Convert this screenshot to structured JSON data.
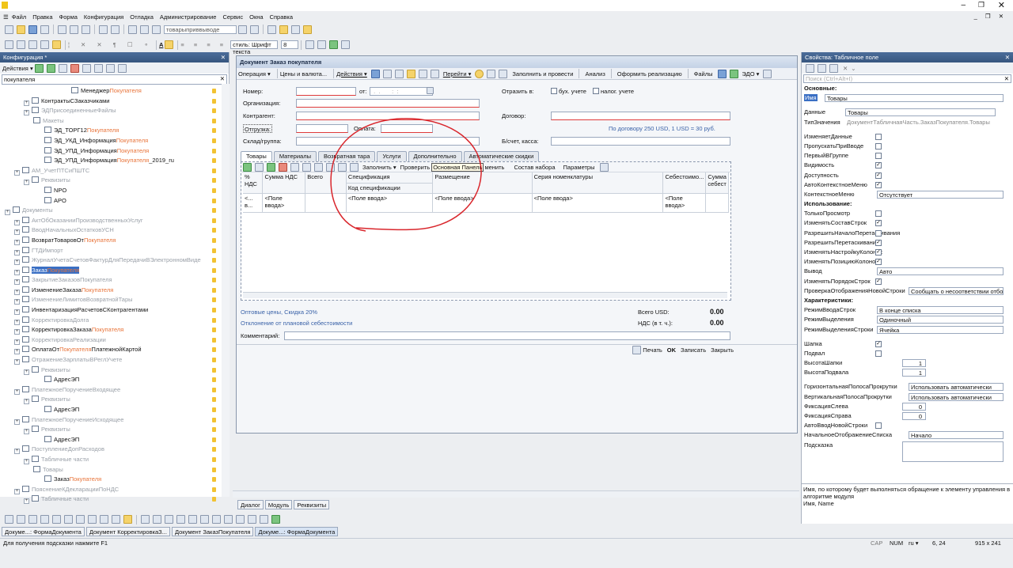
{
  "menubar": [
    "Файл",
    "Правка",
    "Форма",
    "Конфигурация",
    "Отладка",
    "Администрирование",
    "Сервис",
    "Окна",
    "Справка"
  ],
  "toolbar": {
    "combo1": "товарыприввыводе",
    "combo2": "стиль: Шрифт текста",
    "combo3": "8"
  },
  "left": {
    "title": "Конфигурация *",
    "actions": "Действия ▾",
    "search": "покупателя",
    "tree": [
      {
        "pre": "МенеджерПокупателя",
        "indent": 90,
        "parts": [
          [
            "Менеджер",
            ""
          ],
          [
            "Покупателя",
            "o"
          ]
        ]
      },
      {
        "indent": 30,
        "parts": [
          [
            "КонтрактыСЗаказчиками",
            ""
          ]
        ]
      },
      {
        "indent": 30,
        "parts": [
          [
            "ЭДПрисоединенныеФайлы",
            "g"
          ]
        ]
      },
      {
        "indent": 42,
        "parts": [
          [
            "Макеты",
            "g"
          ]
        ]
      },
      {
        "indent": 56,
        "parts": [
          [
            "ЭД_ТОРГ12",
            ""
          ],
          [
            "Покупателя",
            "o"
          ]
        ]
      },
      {
        "indent": 56,
        "parts": [
          [
            "ЭД_УКД_Информация",
            ""
          ],
          [
            "Покупателя",
            "o"
          ]
        ]
      },
      {
        "indent": 56,
        "parts": [
          [
            "ЭД_УПД_Информация",
            ""
          ],
          [
            "Покупателя",
            "o"
          ]
        ]
      },
      {
        "indent": 56,
        "parts": [
          [
            "ЭД_УПД_Информация",
            ""
          ],
          [
            "Покупателя",
            "o"
          ],
          [
            "_2019_ru",
            ""
          ]
        ]
      },
      {
        "indent": 18,
        "parts": [
          [
            "АМ_УчетПТСиПШТС",
            "g"
          ]
        ]
      },
      {
        "indent": 30,
        "parts": [
          [
            "Реквизиты",
            "g"
          ]
        ]
      },
      {
        "indent": 56,
        "parts": [
          [
            "NPO",
            ""
          ]
        ]
      },
      {
        "indent": 56,
        "parts": [
          [
            "APO",
            ""
          ]
        ]
      },
      {
        "indent": 6,
        "parts": [
          [
            "Документы",
            "g"
          ]
        ]
      },
      {
        "indent": 18,
        "parts": [
          [
            "АктОбОказанииПроизводственныхУслуг",
            "g"
          ]
        ]
      },
      {
        "indent": 18,
        "parts": [
          [
            "ВводНачальныхОстатковУСН",
            "g"
          ]
        ]
      },
      {
        "indent": 18,
        "parts": [
          [
            "ВозвратТоваровОт",
            ""
          ],
          [
            "Покупателя",
            "o"
          ]
        ]
      },
      {
        "indent": 18,
        "parts": [
          [
            "ГТДИмпорт",
            "g"
          ]
        ]
      },
      {
        "indent": 18,
        "parts": [
          [
            "ЖурналУчетаСчетовФактурДляПередачиВЭлектронномВиде",
            "g"
          ]
        ]
      },
      {
        "indent": 18,
        "parts": [
          [
            "Заказ",
            ""
          ],
          [
            "Покупателя",
            "o"
          ]
        ],
        "selected": true
      },
      {
        "indent": 18,
        "parts": [
          [
            "ЗакрытиеЗаказовПокупателя",
            "g"
          ]
        ]
      },
      {
        "indent": 18,
        "parts": [
          [
            "ИзменениеЗаказа",
            ""
          ],
          [
            "Покупателя",
            "o"
          ]
        ]
      },
      {
        "indent": 18,
        "parts": [
          [
            "ИзменениеЛимитовВозвратнойТары",
            "g"
          ]
        ]
      },
      {
        "indent": 18,
        "parts": [
          [
            "ИнвентаризацияРасчетовСКонтрагентами",
            ""
          ]
        ]
      },
      {
        "indent": 18,
        "parts": [
          [
            "КорректировкаДолга",
            "g"
          ]
        ]
      },
      {
        "indent": 18,
        "parts": [
          [
            "КорректировкаЗаказа",
            ""
          ],
          [
            "Покупателя",
            "o"
          ]
        ]
      },
      {
        "indent": 18,
        "parts": [
          [
            "КорректировкаРеализации",
            "g"
          ]
        ]
      },
      {
        "indent": 18,
        "parts": [
          [
            "ОплатаОт",
            ""
          ],
          [
            "Покупателя",
            "o"
          ],
          [
            "ПлатежнойКартой",
            ""
          ]
        ]
      },
      {
        "indent": 18,
        "parts": [
          [
            "ОтражениеЗарплатыВРеглУчете",
            "g"
          ]
        ]
      },
      {
        "indent": 30,
        "parts": [
          [
            "Реквизиты",
            "g"
          ]
        ]
      },
      {
        "indent": 56,
        "parts": [
          [
            "АдресЭП",
            ""
          ]
        ]
      },
      {
        "indent": 18,
        "parts": [
          [
            "ПлатежноеПоручениеВходящее",
            "g"
          ]
        ]
      },
      {
        "indent": 30,
        "parts": [
          [
            "Реквизиты",
            "g"
          ]
        ]
      },
      {
        "indent": 56,
        "parts": [
          [
            "АдресЭП",
            ""
          ]
        ]
      },
      {
        "indent": 18,
        "parts": [
          [
            "ПлатежноеПоручениеИсходящее",
            "g"
          ]
        ]
      },
      {
        "indent": 30,
        "parts": [
          [
            "Реквизиты",
            "g"
          ]
        ]
      },
      {
        "indent": 56,
        "parts": [
          [
            "АдресЭП",
            ""
          ]
        ]
      },
      {
        "indent": 18,
        "parts": [
          [
            "ПоступлениеДопРасходов",
            "g"
          ]
        ]
      },
      {
        "indent": 30,
        "parts": [
          [
            "Табличные части",
            "g"
          ]
        ]
      },
      {
        "indent": 42,
        "parts": [
          [
            "Товары",
            "g"
          ]
        ]
      },
      {
        "indent": 56,
        "parts": [
          [
            "Заказ",
            ""
          ],
          [
            "Покупателя",
            "o"
          ]
        ]
      },
      {
        "indent": 18,
        "parts": [
          [
            "ПояснениеКДекларацииПоНДС",
            "g"
          ]
        ]
      },
      {
        "indent": 30,
        "parts": [
          [
            "Табличные части",
            "g"
          ]
        ]
      }
    ]
  },
  "doc": {
    "title": "Документ Заказ покупателя",
    "cmd": [
      "Операция ▾",
      "Цены и валюта...",
      "Действия ▾",
      "Перейти ▾",
      "Заполнить и провести",
      "Анализ",
      "Оформить реализацию",
      "Файлы",
      "ЭДО ▾"
    ],
    "labels": {
      "number": "Номер:",
      "from": "от:",
      "org": "Организация:",
      "kontr": "Контрагент:",
      "otgruzka": "Отгрузка:",
      "oplata": "Оплата:",
      "sklad": "Склад/группа:",
      "dogovor": "Договор:",
      "bschet": "Б/счет, касса:",
      "otrazit": "Отразить в:",
      "buh": "бух. учете",
      "nalog": "налог. учете"
    },
    "date_placeholder": "  .  .       :  :  ",
    "dogovor_note": "По договору 250 USD, 1 USD = 30 руб.",
    "tabs": [
      "Товары",
      "Материалы",
      "Возвратная тара",
      "Услуги",
      "Дополнительно",
      "Автоматические скидки"
    ],
    "gridbar": [
      "Заполнить ▾",
      "Проверить",
      "Основная Панель",
      "менить",
      "Состав набора",
      "Параметры"
    ],
    "columns": [
      "% НДС",
      "Сумма НДС",
      "Всего",
      "Спецификация",
      "Размещение",
      "Серия номенклатуры",
      "Себестоимо...",
      "Сумма себест"
    ],
    "subcol": "Код спецификации",
    "row": {
      "c0": "<...",
      "c0b": "в...",
      "inp": "<Поле ввода>",
      "inp2": "<Поле",
      "inp2b": "ввода>"
    },
    "footer": {
      "prices": "Оптовые цены, Скидка 20%",
      "dev": "Отклонение от плановой себестоимости",
      "total_lbl": "Всего USD:",
      "total": "0.00",
      "vat_lbl": "НДС (в т. ч.):",
      "vat": "0.00",
      "comment": "Комментарий:"
    },
    "buttons": [
      "Печать",
      "OK",
      "Записать",
      "Закрыть"
    ],
    "bottom_tabs": [
      "Диалог",
      "Модуль",
      "Реквизиты"
    ]
  },
  "props": {
    "title": "Свойства: Табличное поле",
    "search": "Поиск (Ctrl+Alt+I)",
    "rows": [
      {
        "t": "sec",
        "l": "Основные:"
      },
      {
        "t": "inp",
        "l": "Имя",
        "v": "Товары",
        "hl": true
      },
      {
        "t": "sp"
      },
      {
        "t": "inp",
        "l": "Данные",
        "v": "Товары"
      },
      {
        "t": "inp",
        "l": "ТипЗначения",
        "v": "ДокументТабличнаяЧасть.ЗаказПокупателя.Товары",
        "g": true
      },
      {
        "t": "sp"
      },
      {
        "t": "cb",
        "l": "ИзменяетДанные",
        "c": false
      },
      {
        "t": "cb",
        "l": "ПропускатьПриВводе",
        "c": false
      },
      {
        "t": "cb",
        "l": "ПервыйВГруппе",
        "c": false
      },
      {
        "t": "cb",
        "l": "Видимость",
        "c": true
      },
      {
        "t": "cb",
        "l": "Доступность",
        "c": true
      },
      {
        "t": "cb",
        "l": "АвтоКонтекстноеМеню",
        "c": true
      },
      {
        "t": "inp",
        "l": "КонтекстноеМеню",
        "v": "Отсутствует"
      },
      {
        "t": "sec",
        "l": "Использование:"
      },
      {
        "t": "cb",
        "l": "ТолькоПросмотр",
        "c": false
      },
      {
        "t": "cb",
        "l": "ИзменятьСоставСтрок",
        "c": true
      },
      {
        "t": "cb",
        "l": "РазрешитьНачалоПеретаскивания",
        "c": false
      },
      {
        "t": "cb",
        "l": "РазрешитьПеретаскивание",
        "c": true
      },
      {
        "t": "cb",
        "l": "ИзменятьНастройкуКолонок",
        "c": true
      },
      {
        "t": "cb",
        "l": "ИзменятьПозициюКолонок",
        "c": true
      },
      {
        "t": "inp",
        "l": "Вывод",
        "v": "Авто"
      },
      {
        "t": "cb",
        "l": "ИзменятьПорядокСтрок",
        "c": true
      },
      {
        "t": "inp",
        "l": "ПроверкаОтображенияНовойСтроки",
        "v": "Сообщать о несоответствии отбору"
      },
      {
        "t": "sec",
        "l": "Характеристики:"
      },
      {
        "t": "inp",
        "l": "РежимВводаСтрок",
        "v": "В конце списка"
      },
      {
        "t": "inp",
        "l": "РежимВыделения",
        "v": "Одиночный"
      },
      {
        "t": "inp",
        "l": "РежимВыделенияСтроки",
        "v": "Ячейка"
      },
      {
        "t": "sp"
      },
      {
        "t": "cb",
        "l": "Шапка",
        "c": true
      },
      {
        "t": "cb",
        "l": "Подвал",
        "c": false
      },
      {
        "t": "num",
        "l": "ВысотаШапки",
        "v": "1"
      },
      {
        "t": "num",
        "l": "ВысотаПодвала",
        "v": "1"
      },
      {
        "t": "sp"
      },
      {
        "t": "inp",
        "l": "ГоризонтальнаяПолосаПрокрутки",
        "v": "Использовать автоматически"
      },
      {
        "t": "inp",
        "l": "ВертикальнаяПолосаПрокрутки",
        "v": "Использовать автоматически"
      },
      {
        "t": "num",
        "l": "ФиксацияСлева",
        "v": "0"
      },
      {
        "t": "num",
        "l": "ФиксацияСправа",
        "v": "0"
      },
      {
        "t": "cb",
        "l": "АвтоВводНовойСтроки",
        "c": false
      },
      {
        "t": "inp",
        "l": "НачальноеОтображениеСписка",
        "v": "Начало"
      },
      {
        "t": "inp",
        "l": "Подсказка",
        "v": ""
      }
    ],
    "help": "Имя, по которому будет выполняться обращение к элементу управления в алгоритме модуля",
    "help2": "Имя, Name"
  },
  "taskbar": [
    "Докуме...: ФормаДокумента",
    "Документ КорректировкаЗ...",
    "Документ ЗаказПокупателя",
    "Докуме...: ФормаДокумента"
  ],
  "status": {
    "hint": "Для получения подсказки нажмите F1",
    "cap": "CAP",
    "num": "NUM",
    "lang": "ru ▾",
    "pos": "6, 24",
    "size": "915 x 241"
  }
}
